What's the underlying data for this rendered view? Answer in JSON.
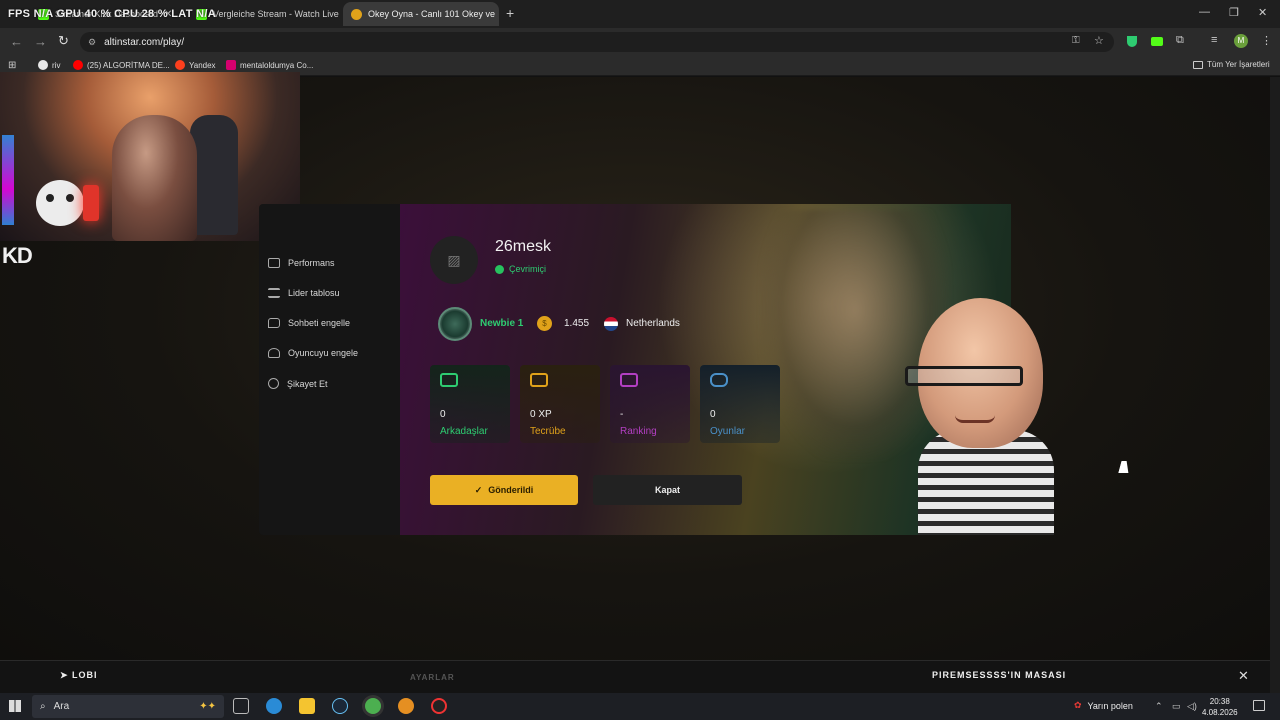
{
  "overlay_stats": "FPS  N/A   GPU 40 %   CPU 28 %   LAT N/A",
  "tabs": [
    {
      "label": "Streamer Kick Dashboard",
      "active": false
    },
    {
      "label": "Vergleiche Stream - Watch Live",
      "active": false
    },
    {
      "label": "Okey Oyna - Canlı 101 Okey ve",
      "active": true
    }
  ],
  "tab_close": "✕",
  "new_tab": "+",
  "window_controls": {
    "minimize": "—",
    "restore": "❐",
    "close": "✕"
  },
  "address_bar": {
    "url": "altinstar.com/play/"
  },
  "bookmarks": [
    {
      "label": "riv",
      "color": "#e8e8e8"
    },
    {
      "label": "(25) ALGORİTMA DE...",
      "color": "#ff0000"
    },
    {
      "label": "Yandex",
      "color": "#fc3f1d"
    },
    {
      "label": "mentaloldumya Co...",
      "color": "#d6006e"
    }
  ],
  "all_bookmarks": "Tüm Yer İşaretleri",
  "profile_initial": "M",
  "streamer_logo": "KD",
  "sidebar": {
    "items": [
      {
        "label": "Performans",
        "icon": "image-icon"
      },
      {
        "label": "Lider tablosu",
        "icon": "list-icon"
      },
      {
        "label": "Sohbeti engelle",
        "icon": "chat-icon"
      },
      {
        "label": "Oyuncuyu engele",
        "icon": "user-block-icon"
      },
      {
        "label": "Şikayet Et",
        "icon": "warning-icon"
      }
    ]
  },
  "profile": {
    "username": "26mesk",
    "status": "Çevrimiçi",
    "rank": "Newbie 1",
    "coins": "1.455",
    "country": "Netherlands"
  },
  "stats": [
    {
      "value": "0",
      "label": "Arkadaşlar",
      "color": "#2ecc71",
      "icon": "friends-icon"
    },
    {
      "value": "0 XP",
      "label": "Tecrübe",
      "color": "#e0a21a",
      "icon": "experience-icon"
    },
    {
      "value": "-",
      "label": "Ranking",
      "color": "#b23fc2",
      "icon": "ranking-icon"
    },
    {
      "value": "0",
      "label": "Oyunlar",
      "color": "#4a90c8",
      "icon": "gamepad-icon"
    }
  ],
  "buttons": {
    "sent": "Gönderildi",
    "close": "Kapat"
  },
  "gamebar": {
    "lobby": "LOBI",
    "settings": "AYARLAR",
    "table": "PIREMSESSSS'IN MASASI",
    "close": "✕"
  },
  "taskbar": {
    "search_placeholder": "Ara",
    "weather": "Yarın polen",
    "time": "20:38",
    "date": "4.08.2026"
  },
  "colors": {
    "accent": "#eab024",
    "online": "#27c25f",
    "background": "#151515"
  }
}
